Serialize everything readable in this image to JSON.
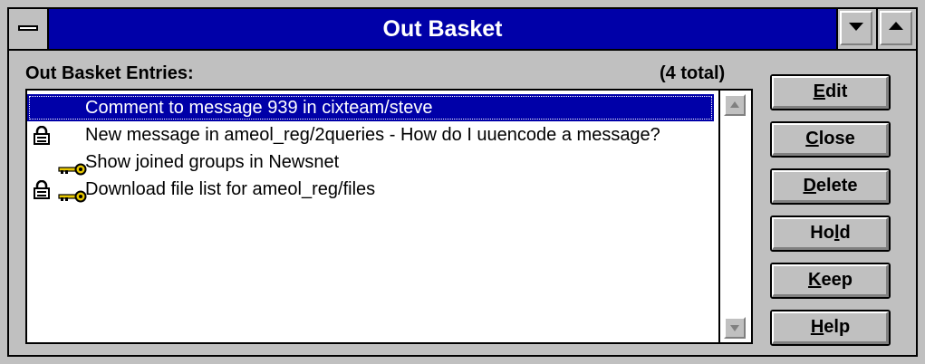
{
  "window": {
    "title": "Out Basket"
  },
  "list_label": "Out Basket Entries:",
  "total_label": "(4 total)",
  "entries": [
    {
      "text": "Comment to message 939 in cixteam/steve",
      "selected": true,
      "locked": false,
      "key": false
    },
    {
      "text": "New message in ameol_reg/2queries - How do I uuencode a message?",
      "selected": false,
      "locked": true,
      "key": false
    },
    {
      "text": "Show joined groups in Newsnet",
      "selected": false,
      "locked": false,
      "key": true
    },
    {
      "text": "Download file list for ameol_reg/files",
      "selected": false,
      "locked": true,
      "key": true
    }
  ],
  "buttons": [
    {
      "pre": "",
      "u": "E",
      "post": "dit"
    },
    {
      "pre": "",
      "u": "C",
      "post": "lose"
    },
    {
      "pre": "",
      "u": "D",
      "post": "elete"
    },
    {
      "pre": "Ho",
      "u": "l",
      "post": "d"
    },
    {
      "pre": "",
      "u": "K",
      "post": "eep"
    },
    {
      "pre": "",
      "u": "H",
      "post": "elp"
    }
  ],
  "colors": {
    "titlebar": "#0000a8",
    "selection": "#0000a8",
    "face": "#c0c0c0",
    "key_icon": "#e8c800"
  },
  "icons": {
    "system_menu": "system-menu-icon",
    "minimize": "minimize-arrow-icon",
    "maximize": "maximize-arrow-icon",
    "lock": "padlock-icon",
    "key": "key-icon"
  }
}
